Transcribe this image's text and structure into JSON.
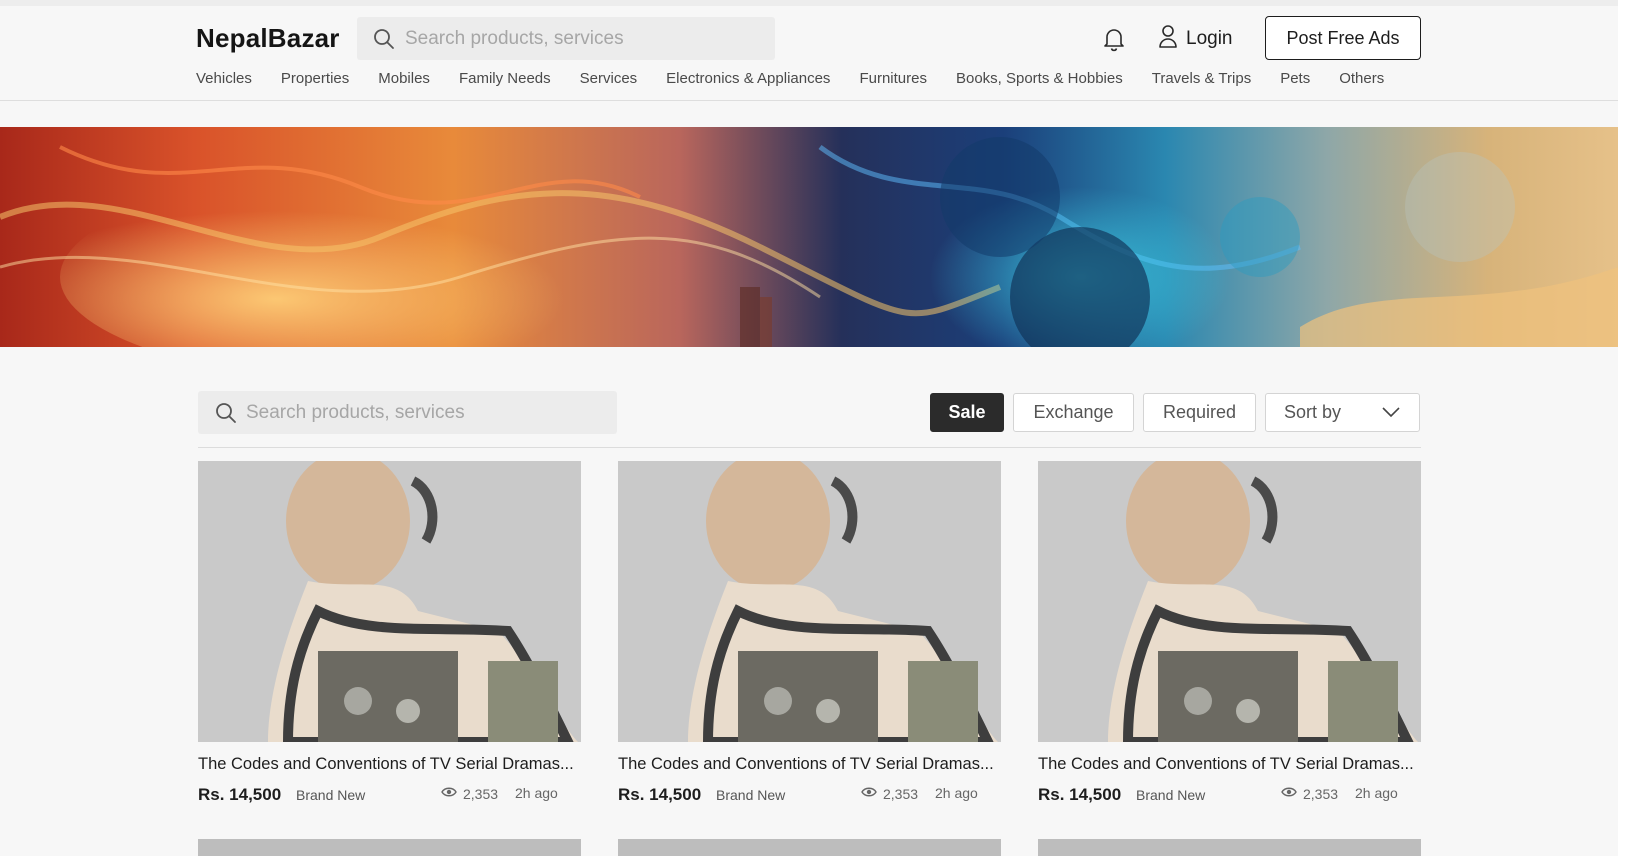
{
  "header": {
    "logo": "NepalBazar",
    "search_placeholder": "Search products, services",
    "login_label": "Login",
    "post_ad_label": "Post Free Ads",
    "categories": [
      "Vehicles",
      "Properties",
      "Mobiles",
      "Family Needs",
      "Services",
      "Electronics & Appliances",
      "Furnitures",
      "Books, Sports & Hobbies",
      "Travels & Trips",
      "Pets",
      "Others"
    ]
  },
  "filters": {
    "search_placeholder": "Search products, services",
    "sale_label": "Sale",
    "exchange_label": "Exchange",
    "required_label": "Required",
    "sort_label": "Sort by",
    "active": "Sale"
  },
  "products": [
    {
      "title": "The Codes and Conventions of TV Serial Dramas...",
      "price": "Rs. 14,500",
      "condition": "Brand New",
      "views": "2,353",
      "posted": "2h ago"
    },
    {
      "title": "The Codes and Conventions of TV Serial Dramas...",
      "price": "Rs. 14,500",
      "condition": "Brand New",
      "views": "2,353",
      "posted": "2h ago"
    },
    {
      "title": "The Codes and Conventions of TV Serial Dramas...",
      "price": "Rs. 14,500",
      "condition": "Brand New",
      "views": "2,353",
      "posted": "2h ago"
    }
  ],
  "icons": {
    "search": "search-icon",
    "bell": "bell-icon",
    "user": "user-icon",
    "eye": "eye-icon",
    "chevron": "chevron-down-icon"
  },
  "colors": {
    "active_filter_bg": "#2b2b2b",
    "page_bg": "#f7f7f7",
    "search_bg": "#ececec"
  }
}
